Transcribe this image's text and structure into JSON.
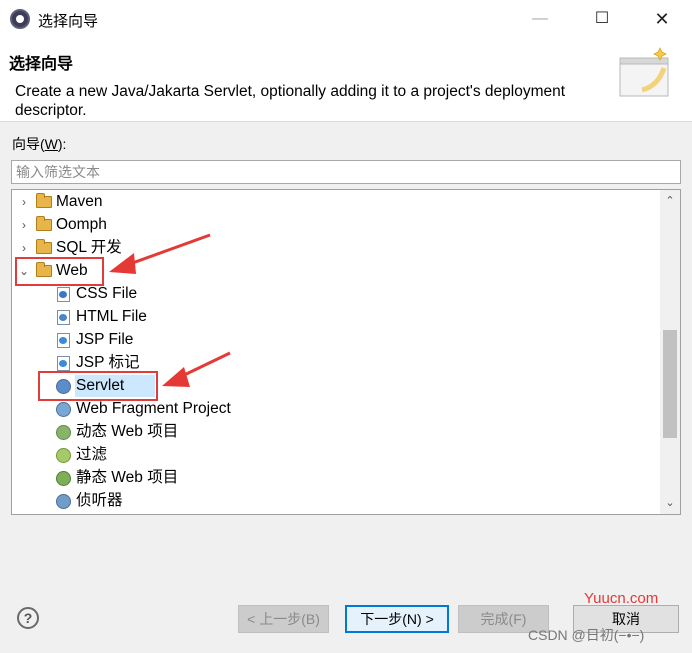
{
  "window": {
    "title": "选择向导"
  },
  "banner": {
    "title": "选择向导",
    "description": "Create a new Java/Jakarta Servlet, optionally adding it to a project's deployment descriptor."
  },
  "filter": {
    "label": "向导(",
    "mnemonic": "W",
    "label_end": "):",
    "placeholder": "输入筛选文本",
    "value": ""
  },
  "tree": {
    "items": [
      {
        "label": "Maven",
        "type": "folder",
        "expanded": false
      },
      {
        "label": "Oomph",
        "type": "folder",
        "expanded": false
      },
      {
        "label": "SQL 开发",
        "type": "folder",
        "expanded": false
      },
      {
        "label": "Web",
        "type": "folder",
        "expanded": true,
        "children": [
          {
            "label": "CSS File",
            "icon": "css-file-icon"
          },
          {
            "label": "HTML File",
            "icon": "html-file-icon"
          },
          {
            "label": "JSP File",
            "icon": "jsp-file-icon"
          },
          {
            "label": "JSP 标记",
            "icon": "jsp-tag-icon"
          },
          {
            "label": "Servlet",
            "icon": "servlet-icon",
            "selected": true
          },
          {
            "label": "Web Fragment Project",
            "icon": "web-fragment-icon"
          },
          {
            "label": "动态 Web 项目",
            "icon": "dynamic-web-project-icon"
          },
          {
            "label": "过滤",
            "icon": "filter-icon"
          },
          {
            "label": "静态 Web 项目",
            "icon": "static-web-project-icon"
          },
          {
            "label": "侦听器",
            "icon": "listener-icon"
          }
        ]
      }
    ]
  },
  "buttons": {
    "back": "< 上一步(B)",
    "next": "下一步(N) >",
    "finish": "完成(F)",
    "cancel": "取消"
  },
  "watermark": {
    "site": "Yuucn.com",
    "author": "CSDN @日初(−•−)"
  },
  "colors": {
    "selection": "#cce8ff",
    "highlight_box": "#e03c3c",
    "primary_border": "#0078d7"
  }
}
